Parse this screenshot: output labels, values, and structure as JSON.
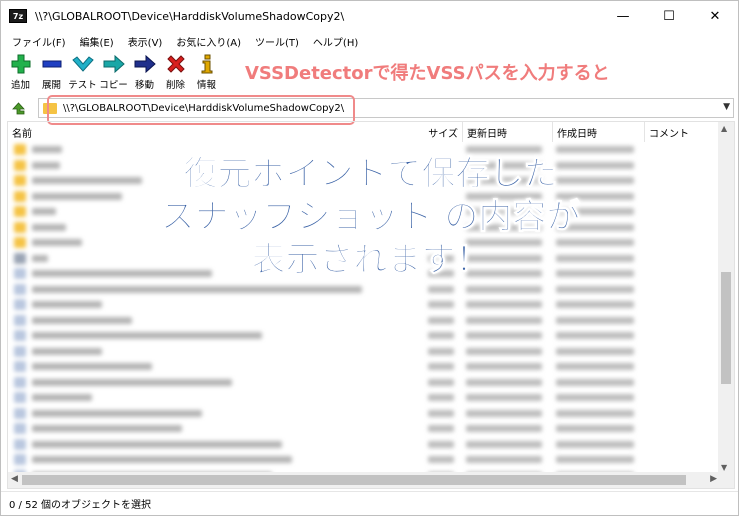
{
  "window": {
    "title": "\\\\?\\GLOBALROOT\\Device\\HarddiskVolumeShadowCopy2\\",
    "app_icon": "7z",
    "controls": {
      "minimize": "—",
      "maximize": "☐",
      "close": "✕"
    }
  },
  "menu": [
    {
      "label": "ファイル(F)"
    },
    {
      "label": "編集(E)"
    },
    {
      "label": "表示(V)"
    },
    {
      "label": "お気に入り(A)"
    },
    {
      "label": "ツール(T)"
    },
    {
      "label": "ヘルプ(H)"
    }
  ],
  "toolbar": [
    {
      "label": "追加",
      "icon": "plus-icon",
      "color": "#22b14c"
    },
    {
      "label": "展開",
      "icon": "minus-icon",
      "color": "#1f3fc2"
    },
    {
      "label": "テスト",
      "icon": "check-icon",
      "color": "#20b0c8"
    },
    {
      "label": "コピー",
      "icon": "arrow-copy-icon",
      "color": "#1aa7a7"
    },
    {
      "label": "移動",
      "icon": "arrow-move-icon",
      "color": "#1f2f8c"
    },
    {
      "label": "削除",
      "icon": "delete-x-icon",
      "color": "#d8201e"
    },
    {
      "label": "情報",
      "icon": "info-icon",
      "color": "#e0a800"
    }
  ],
  "callout": "VSSDetectorで得たVSSパスを入力すると",
  "address": {
    "value": "\\\\?\\GLOBALROOT\\Device\\HarddiskVolumeShadowCopy2\\"
  },
  "columns": {
    "name": "名前",
    "size": "サイズ",
    "modified": "更新日時",
    "created": "作成日時",
    "comment": "コメント"
  },
  "overlay_lines": [
    "復元ポイントで保存した",
    "スナップショット の内容が",
    "表示されます！"
  ],
  "status": "0 / 52 個のオブジェクトを選択",
  "colors": {
    "accent_overlay": "#3a62a6",
    "callout": "#f07c7c",
    "folder": "#f5c344",
    "highlight_border": "#f08a8a"
  }
}
